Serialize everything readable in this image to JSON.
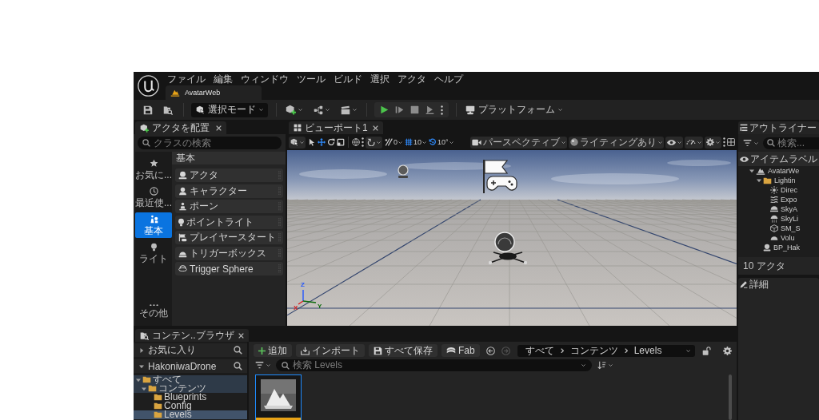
{
  "window": {
    "menu": [
      "ファイル",
      "編集",
      "ウィンドウ",
      "ツール",
      "ビルド",
      "選択",
      "アクタ",
      "ヘルプ"
    ],
    "document_tab": "AvatarWeb"
  },
  "toolbar": {
    "mode_button": "選択モード",
    "platform_button": "プラットフォーム"
  },
  "place_actors": {
    "tab": "アクタを配置",
    "search": {
      "placeholder": "クラスの検索"
    },
    "categories": [
      {
        "label": "お気に...",
        "selected": false
      },
      {
        "label": "最近使...",
        "selected": false
      },
      {
        "label": "基本",
        "selected": true
      },
      {
        "label": "ライト",
        "selected": false
      },
      {
        "label": "その他",
        "selected": false
      }
    ],
    "section": "基本",
    "items": [
      "アクタ",
      "キャラクター",
      "ポーン",
      "ポイントライト",
      "プレイヤースタート",
      "トリガーボックス",
      "Trigger Sphere"
    ]
  },
  "viewport": {
    "tab": "ビューポート1",
    "transform_tools": [
      {
        "selected": false
      },
      {
        "selected": true
      },
      {
        "selected": false
      },
      {
        "selected": false
      }
    ],
    "snaps": [
      {
        "value": "0",
        "on": false
      },
      {
        "value": "10",
        "on": true
      },
      {
        "value": "10°",
        "on": true
      }
    ],
    "view_mode": "パースペクティブ",
    "lighting": "ライティングあり",
    "axis_labels": [
      "Z",
      "X",
      "Y"
    ]
  },
  "outliner": {
    "tab": "アウトライナー",
    "search": {
      "placeholder": "検索..."
    },
    "column": "アイテムラベル",
    "tree": [
      {
        "label": "AvatarWe",
        "kind": "level",
        "expanded": true,
        "children": [
          {
            "label": "Lightin",
            "kind": "folder",
            "expanded": true,
            "children": [
              {
                "label": "Direc",
                "kind": "directional_light"
              },
              {
                "label": "Expo",
                "kind": "fog"
              },
              {
                "label": "SkyA",
                "kind": "atmosphere"
              },
              {
                "label": "SkyLi",
                "kind": "sky_light"
              },
              {
                "label": "SM_S",
                "kind": "static_mesh"
              },
              {
                "label": "Volu",
                "kind": "cloud"
              }
            ]
          },
          {
            "label": "BP_Hak",
            "kind": "blueprint"
          }
        ]
      }
    ],
    "status": "10 アクタ"
  },
  "details": {
    "tab": "詳細"
  },
  "content_browser": {
    "tab": "コンテン..ブラウザ",
    "sections": [
      {
        "label": "お気に入り",
        "expanded": false
      },
      {
        "label": "HakoniwaDrone",
        "expanded": true
      }
    ],
    "tree": [
      {
        "label": "すべて",
        "expanded": true,
        "selected": false,
        "highlighted": true,
        "children": [
          {
            "label": "コンテンツ",
            "expanded": true,
            "selected": false,
            "highlighted": true,
            "children": [
              {
                "label": "Blueprints",
                "selected": false,
                "highlighted": false
              },
              {
                "label": "Config",
                "selected": false,
                "highlighted": false
              },
              {
                "label": "Levels",
                "selected": true,
                "highlighted": false
              }
            ]
          }
        ]
      }
    ],
    "buttons": [
      "追加",
      "インポート",
      "すべて保存",
      "Fab"
    ],
    "history_buttons": [
      {
        "disabled": false
      },
      {
        "disabled": true
      }
    ],
    "path": [
      "すべて",
      "コンテンツ",
      "Levels"
    ],
    "search": {
      "placeholder": "検索 Levels"
    },
    "assets": [
      {
        "selected": true,
        "color": "#e8a317"
      }
    ]
  }
}
